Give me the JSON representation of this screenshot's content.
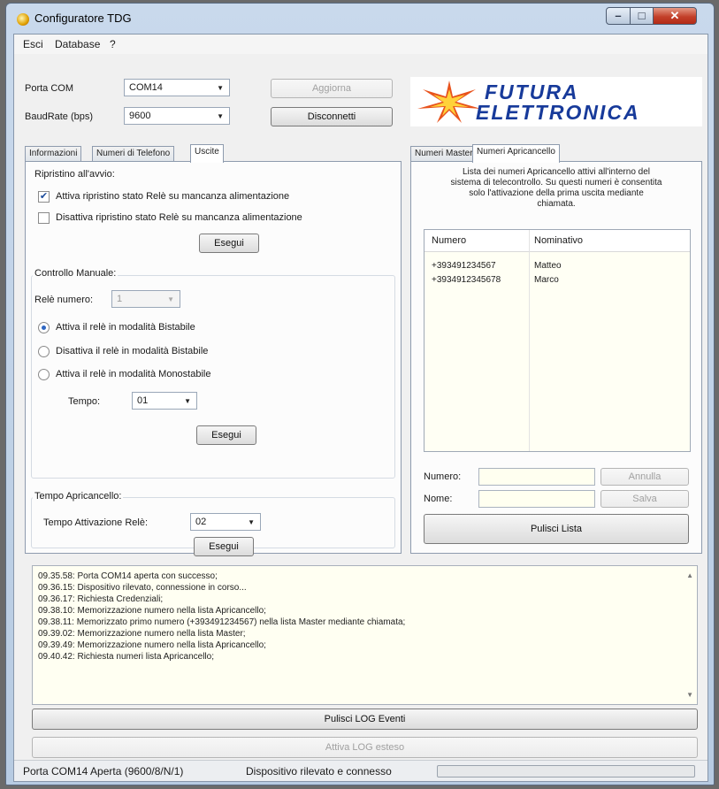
{
  "window": {
    "title": "Configuratore TDG"
  },
  "menu": {
    "items": [
      "Esci",
      "Database",
      "?"
    ]
  },
  "connection": {
    "porta_label": "Porta COM",
    "porta_value": "COM14",
    "baud_label": "BaudRate (bps)",
    "baud_value": "9600",
    "aggiorna_label": "Aggiorna",
    "disconnetti_label": "Disconnetti"
  },
  "logo": {
    "line1": "FUTURA",
    "line2": "ELETTRONICA",
    "color": "#173a9a",
    "star_color": "#e8521c"
  },
  "left_tabs": {
    "items": [
      "Informazioni",
      "Numeri di Telefono",
      "Uscite"
    ],
    "active": "Uscite"
  },
  "uscite": {
    "ripristino": {
      "title": "Ripristino all'avvio:",
      "option1": "Attiva ripristino stato Relè su mancanza alimentazione",
      "option1_checked": true,
      "option2": "Disattiva ripristino stato Relè su mancanza alimentazione",
      "option2_checked": false,
      "esegui": "Esegui"
    },
    "controllo": {
      "title": "Controllo Manuale:",
      "rele_label": "Relè numero:",
      "rele_value": "1",
      "radio1": "Attiva il relè in modalità Bistabile",
      "radio2": "Disattiva il relè in modalità Bistabile",
      "radio3": "Attiva il relè in modalità Monostabile",
      "selected": "radio1",
      "tempo_label": "Tempo:",
      "tempo_value": "01",
      "esegui": "Esegui"
    },
    "apricancello": {
      "title": "Tempo Apricancello:",
      "label": "Tempo Attivazione Relè:",
      "value": "02",
      "esegui": "Esegui"
    }
  },
  "right_tabs": {
    "items": [
      "Numeri Master",
      "Numeri Apricancello"
    ],
    "active": "Numeri Apricancello"
  },
  "apricancello_panel": {
    "description_lines": [
      "Lista dei numeri Apricancello attivi all'interno del",
      "sistema di telecontrollo. Su questi numeri è consentita",
      "solo l'attivazione della prima uscita mediante",
      "chiamata."
    ],
    "columns": [
      "Numero",
      "Nominativo"
    ],
    "rows": [
      {
        "numero": "+393491234567",
        "nominativo": "Matteo"
      },
      {
        "numero": "+3934912345678",
        "nominativo": "Marco"
      }
    ],
    "numero_label": "Numero:",
    "nome_label": "Nome:",
    "annulla": "Annulla",
    "salva": "Salva",
    "pulisci_lista": "Pulisci Lista"
  },
  "log": {
    "lines": [
      "09.35.58: Porta COM14 aperta con successo;",
      "09.36.15: Dispositivo rilevato, connessione in corso...",
      "09.36.17: Richiesta Credenziali;",
      "09.38.10: Memorizzazione numero nella lista Apricancello;",
      "09.38.11: Memorizzato primo numero (+393491234567) nella lista Master mediante chiamata;",
      "09.39.02: Memorizzazione numero nella lista Master;",
      "09.39.49: Memorizzazione numero nella lista Apricancello;",
      "09.40.42: Richiesta numeri lista Apricancello;"
    ],
    "pulisci_log": "Pulisci LOG Eventi",
    "attiva_log": "Attiva LOG esteso"
  },
  "status": {
    "porta": "Porta COM14 Aperta (9600/8/N/1)",
    "dispositivo": "Dispositivo rilevato e connesso",
    "progress": 0.0
  }
}
